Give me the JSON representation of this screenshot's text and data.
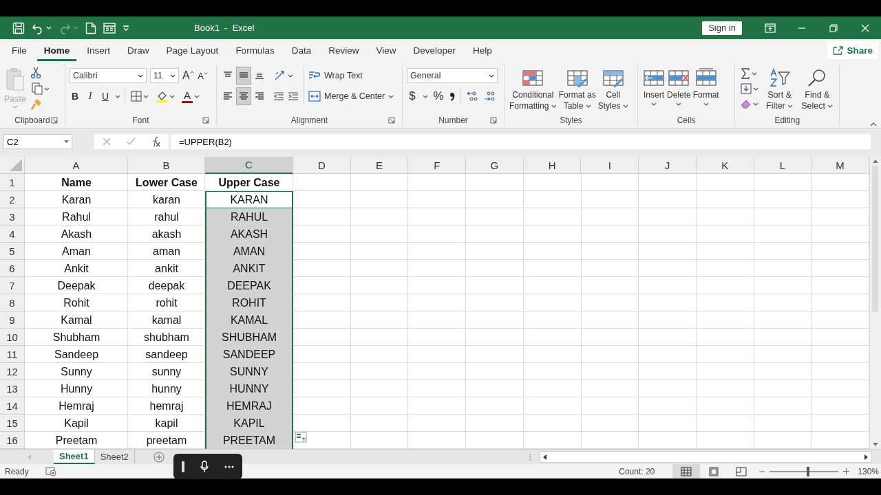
{
  "title_bar": {
    "title": "Book1  -  Excel",
    "sign_in": "Sign in"
  },
  "tabs": [
    {
      "label": "File",
      "selected": false
    },
    {
      "label": "Home",
      "selected": true
    },
    {
      "label": "Insert",
      "selected": false
    },
    {
      "label": "Draw",
      "selected": false
    },
    {
      "label": "Page Layout",
      "selected": false
    },
    {
      "label": "Formulas",
      "selected": false
    },
    {
      "label": "Data",
      "selected": false
    },
    {
      "label": "Review",
      "selected": false
    },
    {
      "label": "View",
      "selected": false
    },
    {
      "label": "Developer",
      "selected": false
    },
    {
      "label": "Help",
      "selected": false
    }
  ],
  "share": "Share",
  "ribbon": {
    "groups": [
      {
        "kind": "clipboard",
        "label": "Clipboard",
        "paste": {
          "label": "Paste",
          "disabled": true
        }
      },
      {
        "kind": "font",
        "label": "Font",
        "font_name": "Calibri",
        "font_size": "11",
        "grow": "A",
        "shrink": "A",
        "styles": [
          "B",
          "I",
          "U"
        ],
        "color_letter": "A"
      },
      {
        "kind": "alignment",
        "label": "Alignment",
        "vertical_align": [
          {
            "selected": false
          },
          {
            "selected": true
          },
          {
            "selected": false
          }
        ],
        "horizontal_align": [
          {
            "selected": false
          },
          {
            "selected": true
          },
          {
            "selected": false
          }
        ],
        "wrap_text": "Wrap Text",
        "merge": "Merge & Center"
      },
      {
        "kind": "number",
        "label": "Number",
        "format": "General",
        "currency": "$",
        "percent": "%"
      },
      {
        "kind": "styles",
        "label": "Styles",
        "buttons": [
          {
            "lines": [
              "Conditional",
              "Formatting"
            ]
          },
          {
            "lines": [
              "Format as",
              "Table"
            ]
          },
          {
            "lines": [
              "Cell",
              "Styles"
            ]
          }
        ]
      },
      {
        "kind": "cells",
        "label": "Cells",
        "buttons": [
          {
            "lines": [
              "Insert"
            ]
          },
          {
            "lines": [
              "Delete"
            ]
          },
          {
            "lines": [
              "Format"
            ]
          }
        ]
      },
      {
        "kind": "editing",
        "label": "Editing",
        "buttons": [
          {
            "lines": [
              "Sort &",
              "Filter"
            ]
          },
          {
            "lines": [
              "Find &",
              "Select"
            ]
          }
        ]
      }
    ]
  },
  "formula_bar": {
    "name_box": "C2",
    "formula": "=UPPER(B2)"
  },
  "grid": {
    "columns": [
      {
        "label": "A",
        "selected": false
      },
      {
        "label": "B",
        "selected": false
      },
      {
        "label": "C",
        "selected": true
      },
      {
        "label": "D",
        "selected": false
      },
      {
        "label": "E",
        "selected": false
      },
      {
        "label": "F",
        "selected": false
      },
      {
        "label": "G",
        "selected": false
      },
      {
        "label": "H",
        "selected": false
      },
      {
        "label": "I",
        "selected": false
      },
      {
        "label": "J",
        "selected": false
      },
      {
        "label": "K",
        "selected": false
      },
      {
        "label": "L",
        "selected": false
      },
      {
        "label": "M",
        "selected": false
      }
    ],
    "rows": [
      {
        "number": "1",
        "cells": [
          "Name",
          "Lower Case",
          "Upper Case"
        ],
        "kind": "header",
        "selected": false,
        "active": false
      },
      {
        "number": "2",
        "cells": [
          "Karan",
          "karan",
          "KARAN"
        ],
        "kind": "data",
        "selected": true,
        "active": true
      },
      {
        "number": "3",
        "cells": [
          "Rahul",
          "rahul",
          "RAHUL"
        ],
        "kind": "data",
        "selected": true,
        "active": false
      },
      {
        "number": "4",
        "cells": [
          "Akash",
          "akash",
          "AKASH"
        ],
        "kind": "data",
        "selected": true,
        "active": false
      },
      {
        "number": "5",
        "cells": [
          "Aman",
          "aman",
          "AMAN"
        ],
        "kind": "data",
        "selected": true,
        "active": false
      },
      {
        "number": "6",
        "cells": [
          "Ankit",
          "ankit",
          "ANKIT"
        ],
        "kind": "data",
        "selected": true,
        "active": false
      },
      {
        "number": "7",
        "cells": [
          "Deepak",
          "deepak",
          "DEEPAK"
        ],
        "kind": "data",
        "selected": true,
        "active": false
      },
      {
        "number": "8",
        "cells": [
          "Rohit",
          "rohit",
          "ROHIT"
        ],
        "kind": "data",
        "selected": true,
        "active": false
      },
      {
        "number": "9",
        "cells": [
          "Kamal",
          "kamal",
          "KAMAL"
        ],
        "kind": "data",
        "selected": true,
        "active": false
      },
      {
        "number": "10",
        "cells": [
          "Shubham",
          "shubham",
          "SHUBHAM"
        ],
        "kind": "data",
        "selected": true,
        "active": false
      },
      {
        "number": "11",
        "cells": [
          "Sandeep",
          "sandeep",
          "SANDEEP"
        ],
        "kind": "data",
        "selected": true,
        "active": false
      },
      {
        "number": "12",
        "cells": [
          "Sunny",
          "sunny",
          "SUNNY"
        ],
        "kind": "data",
        "selected": true,
        "active": false
      },
      {
        "number": "13",
        "cells": [
          "Hunny",
          "hunny",
          "HUNNY"
        ],
        "kind": "data",
        "selected": true,
        "active": false
      },
      {
        "number": "14",
        "cells": [
          "Hemraj",
          "hemraj",
          "HEMRAJ"
        ],
        "kind": "data",
        "selected": true,
        "active": false
      },
      {
        "number": "15",
        "cells": [
          "Kapil",
          "kapil",
          "KAPIL"
        ],
        "kind": "data",
        "selected": true,
        "active": false
      },
      {
        "number": "16",
        "cells": [
          "Preetam",
          "preetam",
          "PREETAM"
        ],
        "kind": "data",
        "selected": true,
        "active": false
      }
    ]
  },
  "sheets": [
    {
      "label": "Sheet1",
      "selected": true
    },
    {
      "label": "Sheet2",
      "selected": false
    }
  ],
  "status_bar": {
    "mode": "Ready",
    "count": "Count: 20",
    "views": [
      {
        "selected": true
      },
      {
        "selected": false
      },
      {
        "selected": false
      }
    ],
    "zoom": {
      "level": 0.56,
      "reading": "130%"
    }
  }
}
